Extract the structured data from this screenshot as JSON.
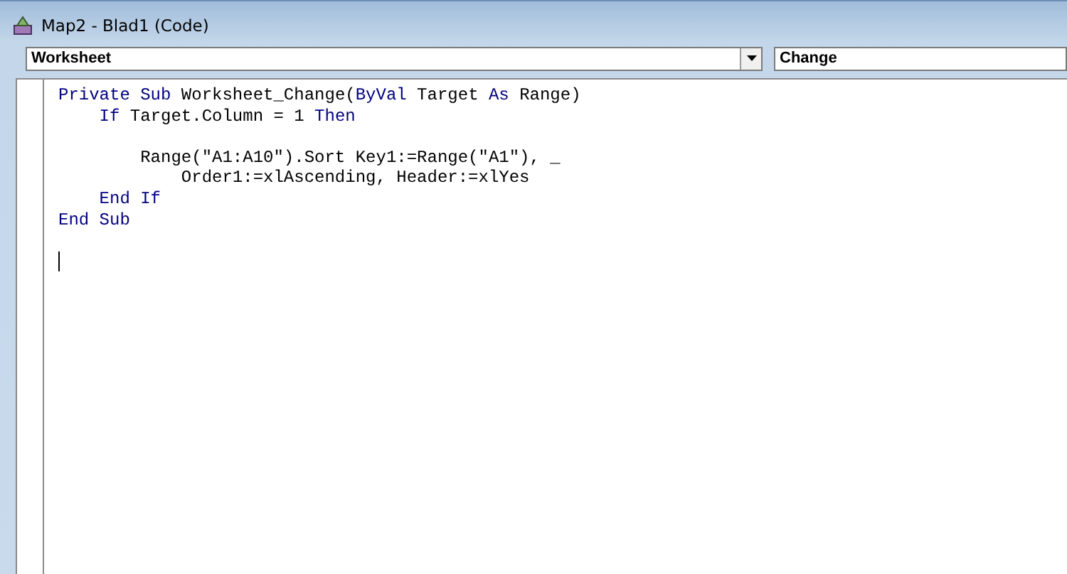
{
  "window": {
    "title": "Map2 - Blad1 (Code)"
  },
  "object_dropdown": {
    "value": "Worksheet"
  },
  "procedure_dropdown": {
    "value": "Change"
  },
  "code_lines": [
    {
      "kind": "code",
      "tokens": [
        {
          "kind": "keyword",
          "text": "Private Sub"
        },
        {
          "kind": "plain",
          "text": " Worksheet_Change("
        },
        {
          "kind": "keyword",
          "text": "ByVal"
        },
        {
          "kind": "plain",
          "text": " Target "
        },
        {
          "kind": "keyword",
          "text": "As"
        },
        {
          "kind": "plain",
          "text": " Range)"
        }
      ]
    },
    {
      "kind": "code",
      "tokens": [
        {
          "kind": "keyword",
          "text": "    If"
        },
        {
          "kind": "plain",
          "text": " Target.Column = 1 "
        },
        {
          "kind": "keyword",
          "text": "Then"
        }
      ]
    },
    {
      "kind": "blank"
    },
    {
      "kind": "code",
      "tokens": [
        {
          "kind": "plain",
          "text": "        Range(\"A1:A10\").Sort Key1:=Range(\"A1\"), _"
        }
      ]
    },
    {
      "kind": "code",
      "tokens": [
        {
          "kind": "plain",
          "text": "            Order1:=xlAscending, Header:=xlYes"
        }
      ]
    },
    {
      "kind": "code",
      "tokens": [
        {
          "kind": "keyword",
          "text": "    End If"
        }
      ]
    },
    {
      "kind": "code",
      "tokens": [
        {
          "kind": "keyword",
          "text": "End Sub"
        }
      ]
    },
    {
      "kind": "blank"
    },
    {
      "kind": "cursor"
    }
  ]
}
